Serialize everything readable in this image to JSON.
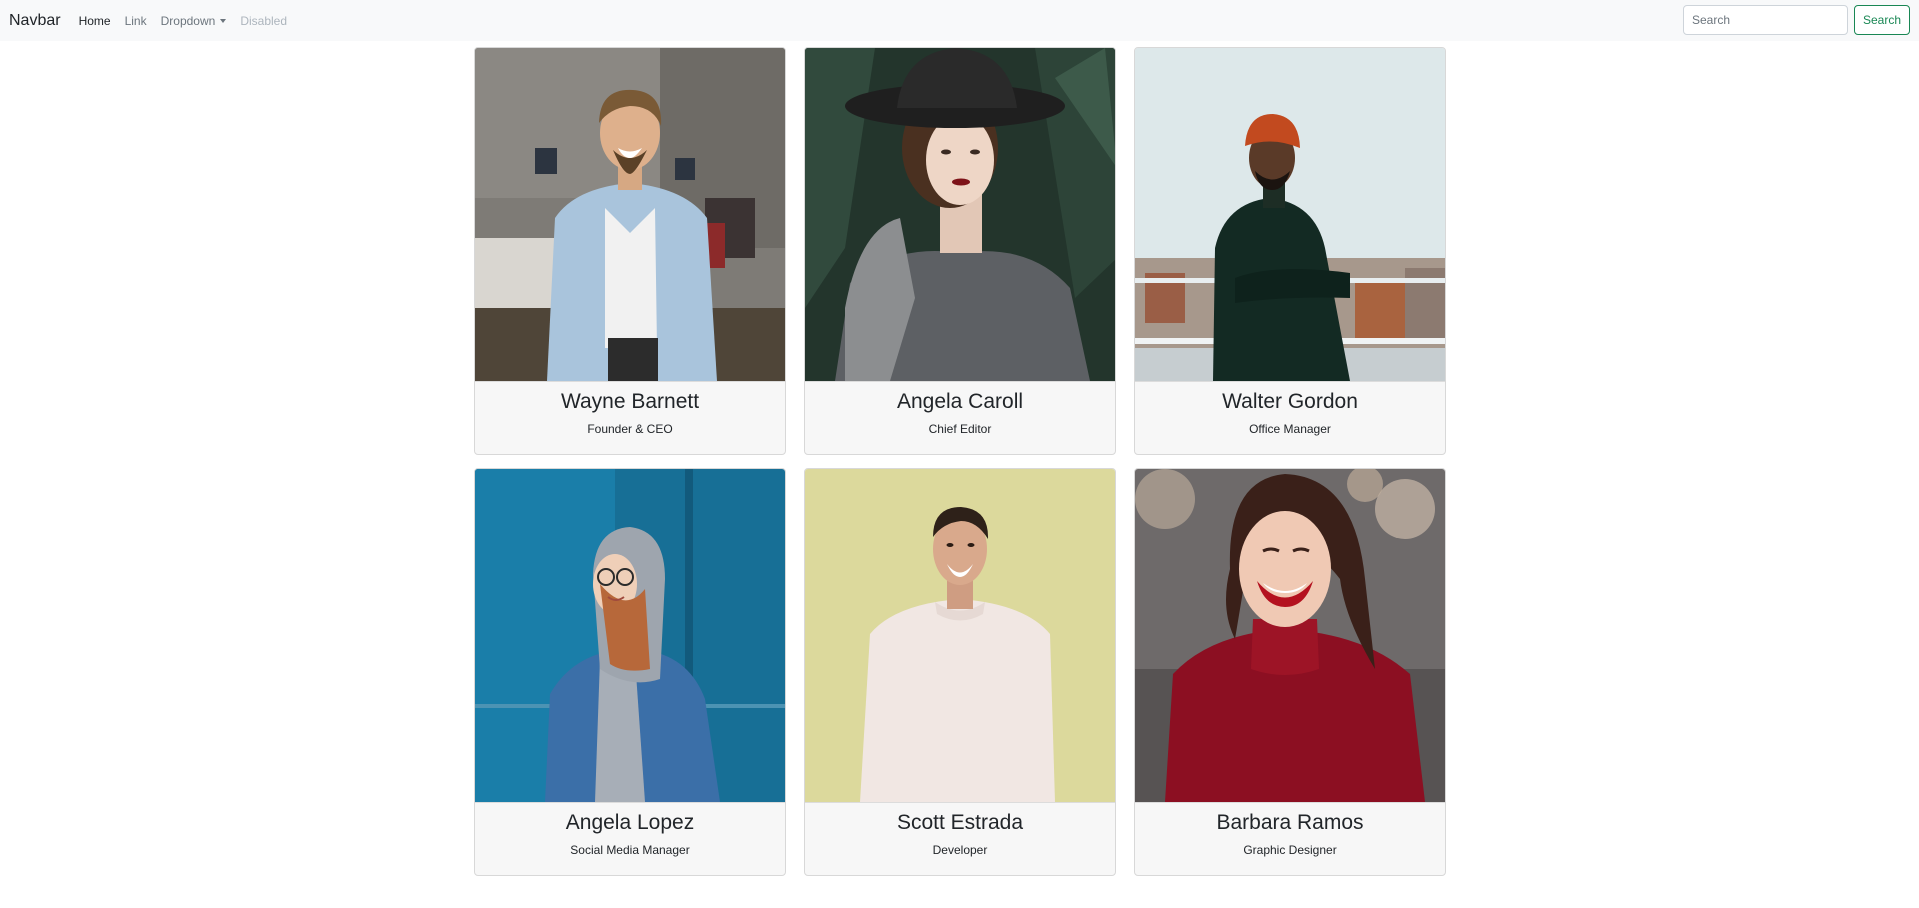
{
  "navbar": {
    "brand": "Navbar",
    "links": [
      {
        "label": "Home",
        "state": "active"
      },
      {
        "label": "Link",
        "state": "default"
      },
      {
        "label": "Dropdown",
        "state": "dropdown"
      },
      {
        "label": "Disabled",
        "state": "disabled"
      }
    ],
    "search": {
      "placeholder": "Search",
      "value": "",
      "button_label": "Search"
    }
  },
  "team": [
    {
      "name": "Wayne Barnett",
      "role": "Founder & CEO"
    },
    {
      "name": "Angela Caroll",
      "role": "Chief Editor"
    },
    {
      "name": "Walter Gordon",
      "role": "Office Manager"
    },
    {
      "name": "Angela Lopez",
      "role": "Social Media Manager"
    },
    {
      "name": "Scott Estrada",
      "role": "Developer"
    },
    {
      "name": "Barbara Ramos",
      "role": "Graphic Designer"
    }
  ],
  "colors": {
    "accent_success": "#198754",
    "navbar_bg": "#f8f9fa"
  }
}
